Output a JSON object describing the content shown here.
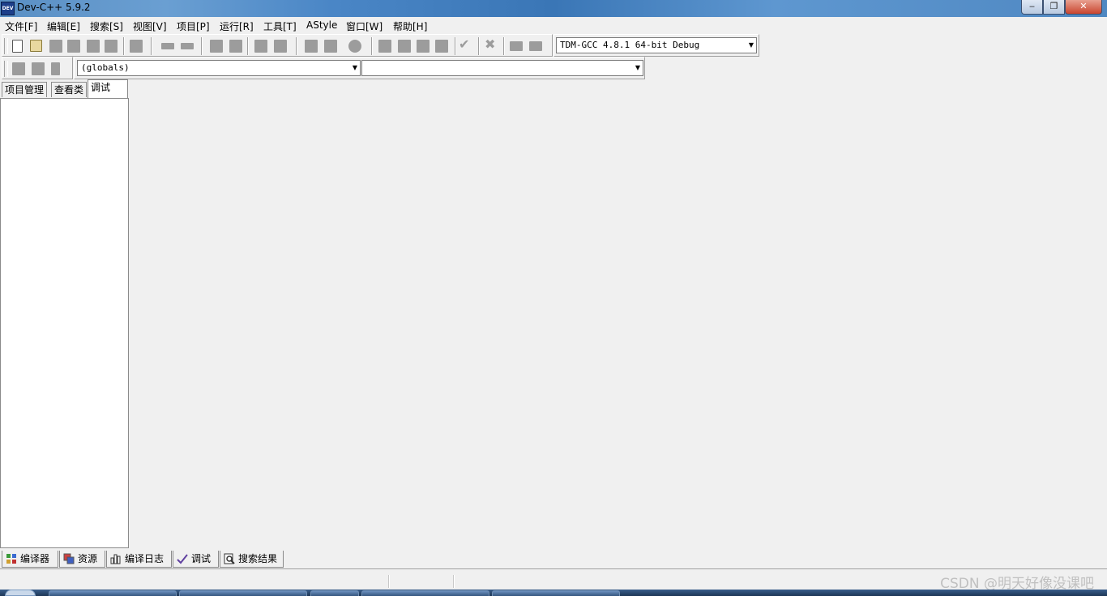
{
  "window": {
    "title": "Dev-C++ 5.9.2",
    "icon_label": "DEV",
    "controls": {
      "minimize": "‒",
      "maximize": "❐",
      "close": "✕"
    }
  },
  "menu": {
    "items": [
      "文件[F]",
      "编辑[E]",
      "搜索[S]",
      "视图[V]",
      "项目[P]",
      "运行[R]",
      "工具[T]",
      "AStyle",
      "窗口[W]",
      "帮助[H]"
    ]
  },
  "toolbar": {
    "compiler_select": "TDM-GCC 4.8.1 64-bit Debug",
    "globals_select": "(globals)",
    "members_select": ""
  },
  "left_panel": {
    "tabs": [
      "项目管理",
      "查看类",
      "调试"
    ],
    "active_tab": "调试"
  },
  "bottom_tabs": [
    "编译器",
    "资源",
    "编译日志",
    "调试",
    "搜索结果"
  ],
  "watermark": "CSDN @明天好像没课吧",
  "colors": {
    "titlebar": "#4a86c6",
    "close_button": "#c9452f",
    "background": "#f0f0f0"
  },
  "icons": {
    "toolbar1": [
      "new-file-icon",
      "open-file-icon",
      "save-icon",
      "save-all-icon",
      "close-icon",
      "close-all-icon",
      "print-icon",
      "undo-icon",
      "redo-icon",
      "find-icon",
      "replace-icon",
      "indent-icon",
      "unindent-icon",
      "bookmark-prev-icon",
      "bookmark-next-icon",
      "goto-line-icon",
      "compile-icon",
      "run-icon",
      "compile-run-icon",
      "rebuild-icon",
      "syntax-check-icon",
      "stop-icon",
      "profile-icon",
      "delete-profile-icon"
    ],
    "toolbar2": [
      "insert-icon",
      "toggle-bookmark-icon",
      "goto-bookmark-icon"
    ]
  }
}
